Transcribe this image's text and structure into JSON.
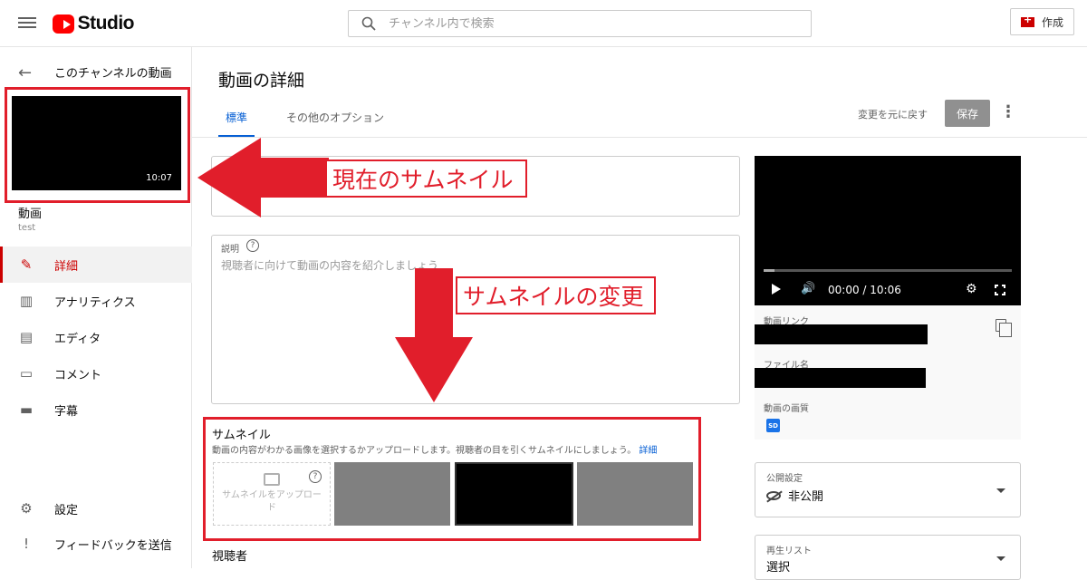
{
  "header": {
    "logo_text": "Studio",
    "search_placeholder": "チャンネル内で検索",
    "create_label": "作成"
  },
  "sidebar": {
    "back_title": "このチャンネルの動画",
    "thumbnail_duration": "10:07",
    "video_title": "動画",
    "video_subtitle": "test",
    "items": [
      {
        "label": "詳細",
        "icon": "pencil-icon",
        "active": true
      },
      {
        "label": "アナリティクス",
        "icon": "analytics-icon",
        "active": false
      },
      {
        "label": "エディタ",
        "icon": "editor-icon",
        "active": false
      },
      {
        "label": "コメント",
        "icon": "comment-icon",
        "active": false
      },
      {
        "label": "字幕",
        "icon": "subtitles-icon",
        "active": false
      }
    ],
    "bottom_items": [
      {
        "label": "設定",
        "icon": "gear-icon"
      },
      {
        "label": "フィードバックを送信",
        "icon": "feedback-icon"
      }
    ]
  },
  "main": {
    "page_title": "動画の詳細",
    "tabs": [
      {
        "label": "標準",
        "active": true
      },
      {
        "label": "その他のオプション",
        "active": false
      }
    ],
    "revert_label": "変更を元に戻す",
    "save_label": "保存",
    "description_label": "説明",
    "description_placeholder": "視聴者に向けて動画の内容を紹介しましょう",
    "thumbnail_heading": "サムネイル",
    "thumbnail_desc": "動画の内容がわかる画像を選択するかアップロードします。視聴者の目を引くサムネイルにしましょう。",
    "thumbnail_desc_link": "詳細",
    "upload_label": "サムネイルをアップロード",
    "audience_heading": "視聴者"
  },
  "right": {
    "player_time": "00:00 / 10:06",
    "video_link_label": "動画リンク",
    "file_name_label": "ファイル名",
    "quality_label": "動画の画質",
    "quality_badge": "SD",
    "visibility_label": "公開設定",
    "visibility_value": "非公開",
    "playlist_label": "再生リスト",
    "playlist_value": "選択"
  },
  "annotations": {
    "current_thumb_label": "現在のサムネイル",
    "change_thumb_label": "サムネイルの変更",
    "color": "#e11e2b"
  }
}
